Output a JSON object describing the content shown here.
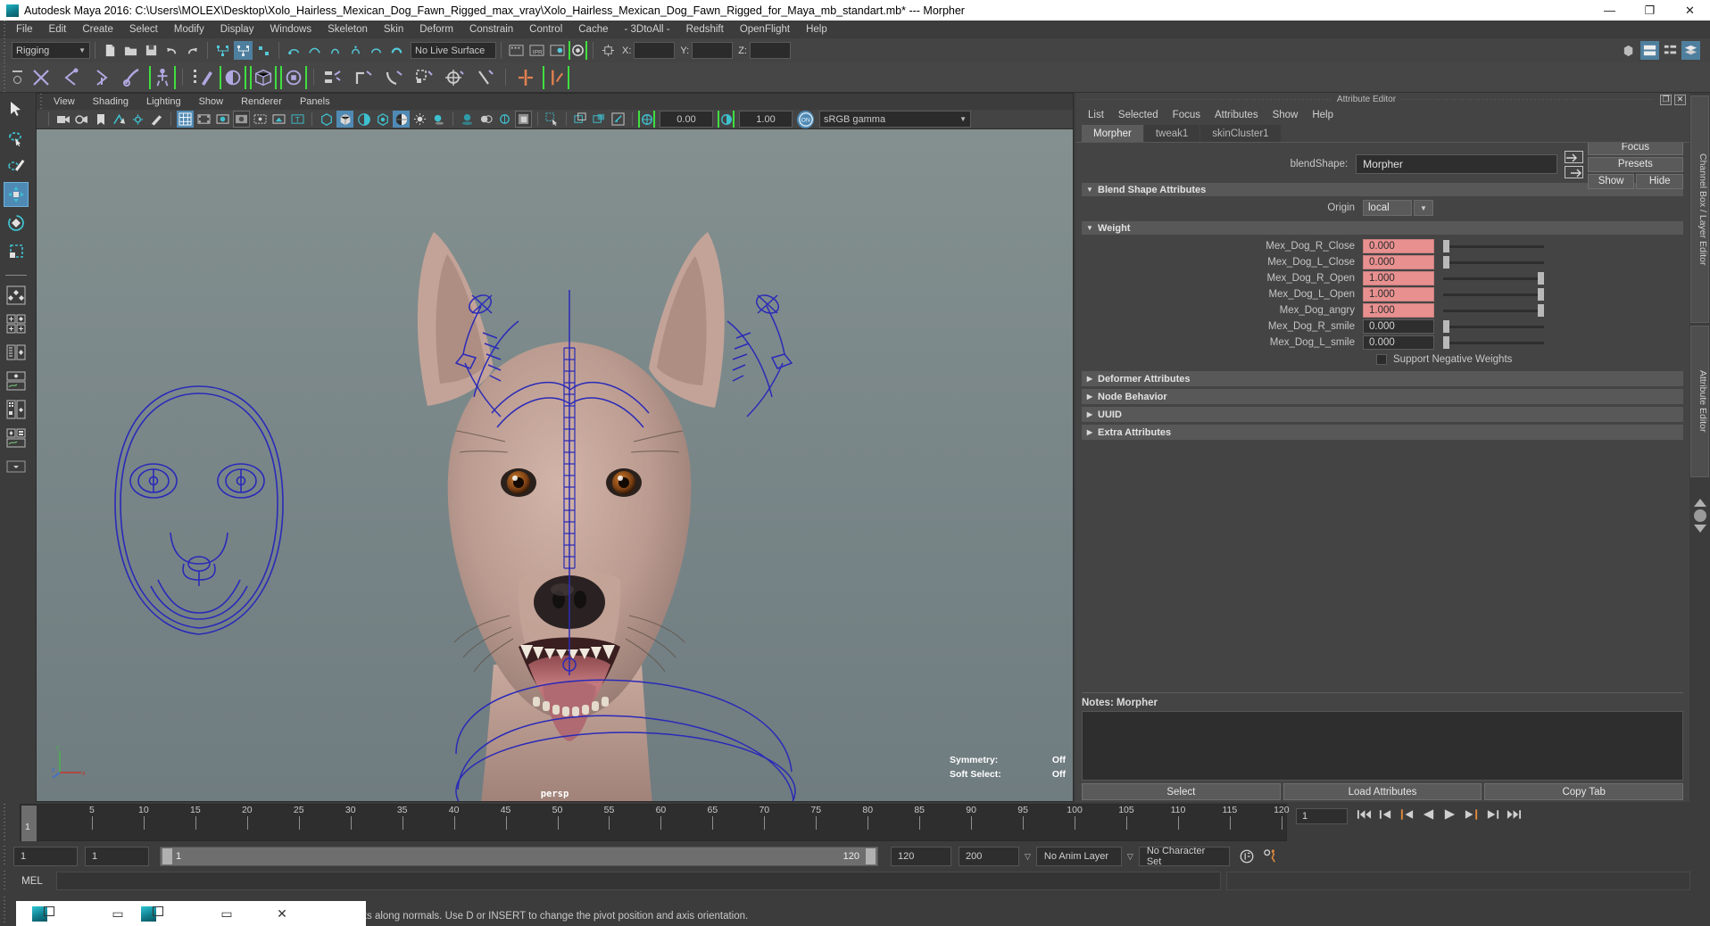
{
  "window": {
    "title": "Autodesk Maya 2016: C:\\Users\\MOLEX\\Desktop\\Xolo_Hairless_Mexican_Dog_Fawn_Rigged_max_vray\\Xolo_Hairless_Mexican_Dog_Fawn_Rigged_for_Maya_mb_standart.mb*  ---  Morpher",
    "minimize": "—",
    "restore": "❐",
    "close": "✕"
  },
  "menubar": {
    "items": [
      "File",
      "Edit",
      "Create",
      "Select",
      "Modify",
      "Display",
      "Windows",
      "Skeleton",
      "Skin",
      "Deform",
      "Constrain",
      "Control",
      "Cache",
      "- 3DtoAll -",
      "Redshift",
      "OpenFlight",
      "Help"
    ]
  },
  "statusbar": {
    "menuset": "Rigging",
    "live_surface": "No Live Surface",
    "coord_x_label": "X:",
    "coord_y_label": "Y:",
    "coord_z_label": "Z:",
    "coord_x_value": "",
    "coord_y_value": "",
    "coord_z_value": ""
  },
  "viewport": {
    "menus": [
      "View",
      "Shading",
      "Lighting",
      "Show",
      "Renderer",
      "Panels"
    ],
    "exposure_value": "0.00",
    "gamma_value": "1.00",
    "color_management_toggle": "ON",
    "color_profile": "sRGB gamma",
    "camera_label": "persp",
    "symmetry_label": "Symmetry:",
    "symmetry_value": "Off",
    "soft_select_label": "Soft Select:",
    "soft_select_value": "Off",
    "axis_x": "x",
    "axis_y": "y",
    "axis_z": "z"
  },
  "attribute_editor": {
    "panel_title": "Attribute Editor",
    "restore_icon": "❐",
    "close_icon": "✕",
    "menus": [
      "List",
      "Selected",
      "Focus",
      "Attributes",
      "Show",
      "Help"
    ],
    "tabs": [
      {
        "label": "Morpher",
        "active": true
      },
      {
        "label": "tweak1",
        "active": false
      },
      {
        "label": "skinCluster1",
        "active": false
      }
    ],
    "blendshape_label": "blendShape:",
    "blendshape_value": "Morpher",
    "focus_button": "Focus",
    "presets_button": "Presets",
    "show_button": "Show",
    "hide_button": "Hide",
    "sections": {
      "blend_shape_attributes": "Blend Shape Attributes",
      "origin_label": "Origin",
      "origin_value": "local",
      "weight": "Weight"
    },
    "weights": [
      {
        "name": "Mex_Dog_R_Close",
        "value": "0.000",
        "fraction": 0.0,
        "keyed": true
      },
      {
        "name": "Mex_Dog_L_Close",
        "value": "0.000",
        "fraction": 0.0,
        "keyed": true
      },
      {
        "name": "Mex_Dog_R_Open",
        "value": "1.000",
        "fraction": 1.0,
        "keyed": true
      },
      {
        "name": "Mex_Dog_L_Open",
        "value": "1.000",
        "fraction": 1.0,
        "keyed": true
      },
      {
        "name": "Mex_Dog_angry",
        "value": "1.000",
        "fraction": 1.0,
        "keyed": true
      },
      {
        "name": "Mex_Dog_R_smile",
        "value": "0.000",
        "fraction": 0.0,
        "keyed": false
      },
      {
        "name": "Mex_Dog_L_smile",
        "value": "0.000",
        "fraction": 0.0,
        "keyed": false
      }
    ],
    "support_negative_weights": "Support Negative Weights",
    "collapsed_sections": [
      "Deformer Attributes",
      "Node Behavior",
      "UUID",
      "Extra Attributes"
    ],
    "notes_label": "Notes:  Morpher",
    "notes_value": "",
    "bottom_buttons": [
      "Select",
      "Load Attributes",
      "Copy Tab"
    ]
  },
  "side_tabs": [
    "Channel Box / Layer Editor",
    "Attribute Editor"
  ],
  "timeline": {
    "tick_labels": [
      "5",
      "10",
      "15",
      "20",
      "25",
      "30",
      "35",
      "40",
      "45",
      "50",
      "55",
      "60",
      "65",
      "70",
      "75",
      "80",
      "85",
      "90",
      "95",
      "100",
      "105",
      "110",
      "115",
      "120"
    ],
    "current_frame_marker": "1",
    "current_frame_field": "1",
    "playback_buttons": [
      "go-to-start",
      "step-back-keyframe",
      "step-back-frame",
      "play-backwards",
      "play-forwards",
      "step-forward-frame",
      "step-forward-keyframe",
      "go-to-end"
    ]
  },
  "range_slider": {
    "anim_start": "1",
    "range_start": "1",
    "bar_start_label": "1",
    "bar_end_label": "120",
    "range_end": "120",
    "anim_end": "200",
    "anim_layer": "No Anim Layer",
    "character_set": "No Character Set"
  },
  "command_line": {
    "language": "MEL",
    "input_value": "",
    "output_value": ""
  },
  "help_line": {
    "text": "to move components along normals. Use D or INSERT to change the pivot position and axis orientation.",
    "fragment_text": "to"
  },
  "minimized_windows": [
    {
      "restore": "❐",
      "minimize": "▭",
      "close": "✕"
    },
    {
      "restore": "❐",
      "minimize": "▭",
      "close": "✕"
    }
  ],
  "colors": {
    "accent_blue": "#4f8ab5",
    "keyed_pink": "#e89090",
    "shelf_green": "#3fe03f",
    "panel_bg": "#444444",
    "window_bg": "#3c3c3c",
    "viewport_bg": "#7c8a8c",
    "rig_curve_blue": "#2a2ab8"
  }
}
